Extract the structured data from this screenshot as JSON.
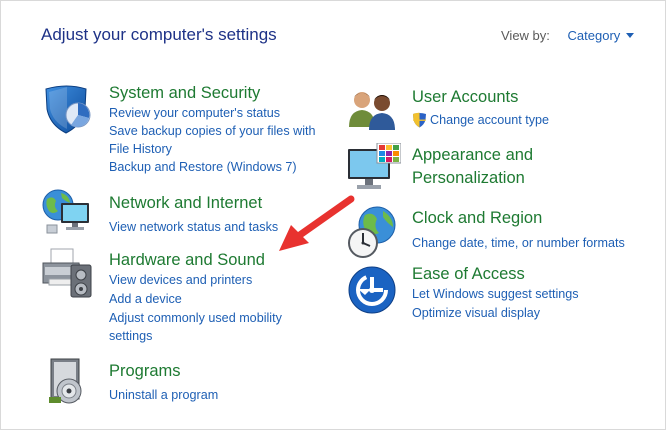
{
  "header": {
    "title": "Adjust your computer's settings",
    "view_by_label": "View by:",
    "view_by_value": "Category"
  },
  "left": {
    "system": {
      "title": "System and Security",
      "links": [
        "Review your computer's status",
        "Save backup copies of your files with",
        "File History",
        "Backup and Restore (Windows 7)"
      ]
    },
    "network": {
      "title": "Network and Internet",
      "links": [
        "View network status and tasks"
      ]
    },
    "hardware": {
      "title": "Hardware and Sound",
      "links": [
        "View devices and printers",
        "Add a device",
        "Adjust commonly used mobility",
        "settings"
      ]
    },
    "programs": {
      "title": "Programs",
      "links": [
        "Uninstall a program"
      ]
    }
  },
  "right": {
    "user": {
      "title": "User Accounts",
      "links": [
        "Change account type"
      ]
    },
    "appearance": {
      "title_line1": "Appearance and",
      "title_line2": "Personalization"
    },
    "clock": {
      "title": "Clock and Region",
      "links": [
        "Change date, time, or number formats"
      ]
    },
    "ease": {
      "title": "Ease of Access",
      "links": [
        "Let Windows suggest settings",
        "Optimize visual display"
      ]
    }
  },
  "colors": {
    "category_title": "#1e7a32",
    "link": "#1e5fb4",
    "page_title": "#1e3287",
    "arrow": "#e8322f"
  },
  "icons": {
    "system": "shield-icon",
    "network": "network-globe-icon",
    "hardware": "printer-speaker-icon",
    "programs": "program-disc-icon",
    "user": "users-icon",
    "uac": "uac-shield-icon",
    "appearance": "monitor-palette-icon",
    "clock": "globe-clock-icon",
    "ease": "ease-of-access-icon",
    "arrow": "red-arrow-annotation"
  }
}
